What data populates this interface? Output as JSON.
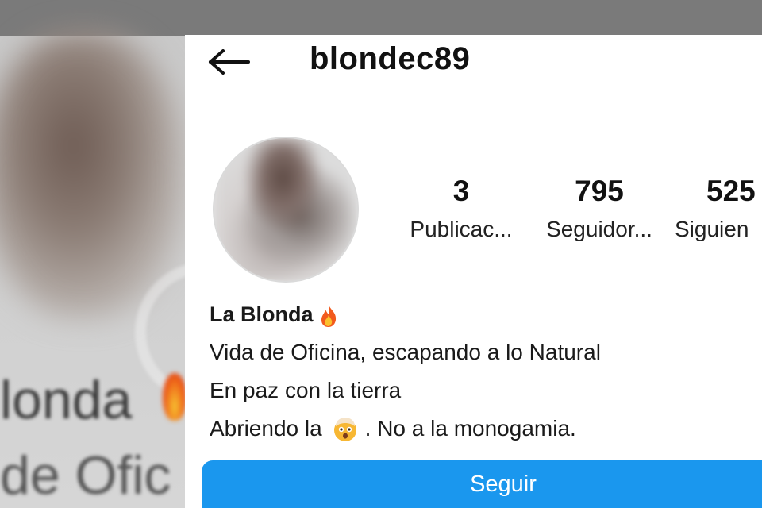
{
  "profile": {
    "username": "blondec89",
    "display_name": "La Blonda",
    "bio": [
      "Vida de Oficina, escapando a lo Natural",
      "En paz con la tierra",
      "Abriendo la",
      ". No a la monogamia."
    ]
  },
  "stats": {
    "posts": {
      "value": "3",
      "label": "Publicac..."
    },
    "followers": {
      "value": "795",
      "label": "Seguidor..."
    },
    "following": {
      "value": "525",
      "label": "Siguien"
    }
  },
  "buttons": {
    "follow_label": "Seguir"
  },
  "background": {
    "name_fragment": "londa",
    "bio_fragment": "de Ofic"
  },
  "icons": {
    "back": "arrow-left-icon",
    "fire": "fire-emoji-icon",
    "shocked": "exploding-head-emoji-icon"
  },
  "colors": {
    "accent": "#1a97ee",
    "text": "#111111",
    "card": "#ffffff"
  }
}
